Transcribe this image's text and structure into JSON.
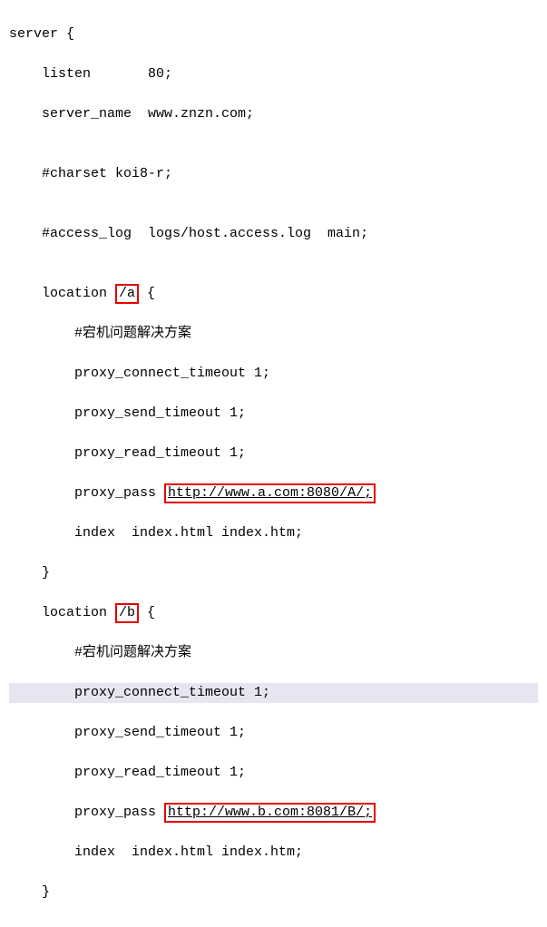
{
  "code": {
    "l1": "server {",
    "l2": "    listen       80;",
    "l3": "    server_name  www.znzn.com;",
    "l4": "",
    "l5": "    #charset koi8-r;",
    "l6": "",
    "l7": "    #access_log  logs/host.access.log  main;",
    "l8": "",
    "l9a": "    location ",
    "l9b": "/a",
    "l9c": " {",
    "l10": "        #宕机问题解决方案",
    "l11": "        proxy_connect_timeout 1;",
    "l12": "        proxy_send_timeout 1;",
    "l13": "        proxy_read_timeout 1;",
    "l14a": "        proxy_pass ",
    "l14b": "http://www.a.com:8080/A/;",
    "l15": "        index  index.html index.htm;",
    "l16": "    }",
    "l17a": "    location ",
    "l17b": "/b",
    "l17c": " {",
    "l18": "        #宕机问题解决方案",
    "l19": "        proxy_connect_timeout 1;",
    "l20": "        proxy_send_timeout 1;",
    "l21": "        proxy_read_timeout 1;",
    "l22a": "        proxy_pass ",
    "l22b": "http://www.b.com:8081/B/;",
    "l23": "        index  index.html index.htm;",
    "l24": "    }"
  }
}
